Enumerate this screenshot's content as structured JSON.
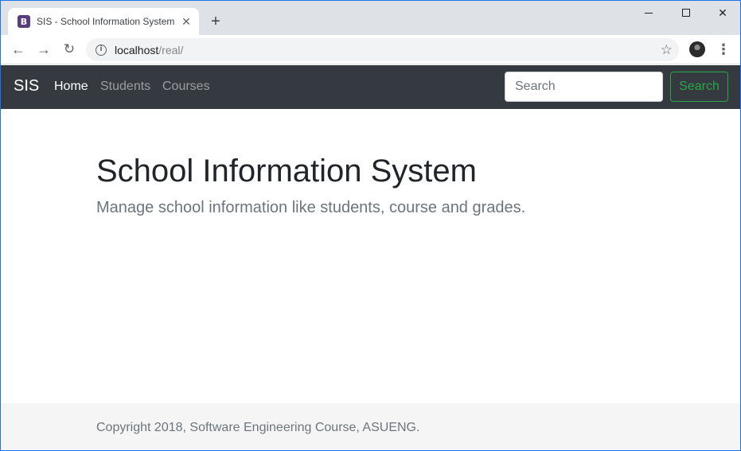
{
  "browser": {
    "tab": {
      "favicon_letter": "B",
      "title": "SIS - School Information System",
      "close_glyph": "✕"
    },
    "new_tab_glyph": "+",
    "address": {
      "host": "localhost",
      "path": "/real/"
    },
    "icons": {
      "back": "←",
      "forward": "→",
      "reload": "↻",
      "info": "i",
      "star": "☆",
      "menu": "⋮",
      "close": "✕"
    }
  },
  "navbar": {
    "brand": "SIS",
    "links": [
      {
        "label": "Home",
        "active": true
      },
      {
        "label": "Students",
        "active": false
      },
      {
        "label": "Courses",
        "active": false
      }
    ],
    "search": {
      "placeholder": "Search",
      "button_label": "Search"
    }
  },
  "jumbotron": {
    "title": "School Information System",
    "lead": "Manage school information like students, course and grades."
  },
  "footer": {
    "text": "Copyright 2018, Software Engineering Course, ASUENG."
  },
  "colors": {
    "navbar_bg": "#343a40",
    "success": "#28a745",
    "footer_bg": "#f5f5f5",
    "favicon_bg": "#563d7c"
  }
}
